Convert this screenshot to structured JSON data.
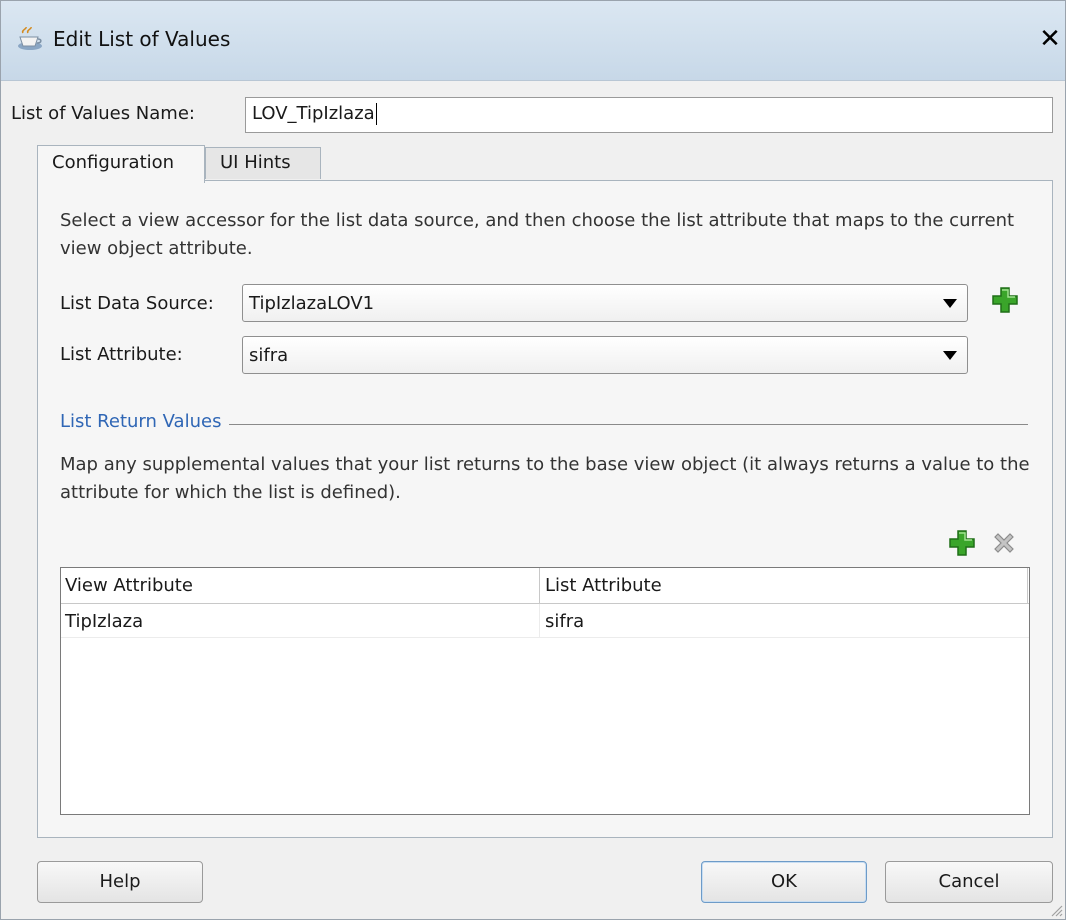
{
  "window": {
    "title": "Edit List of Values",
    "close_glyph": "✕"
  },
  "name_field": {
    "label": "List of Values Name:",
    "value": "LOV_TipIzlaza"
  },
  "tabs": [
    {
      "label": "Configuration",
      "selected": true
    },
    {
      "label": "UI Hints",
      "selected": false
    }
  ],
  "configuration": {
    "description": "Select a view accessor for the list data source, and then choose the list attribute that maps to the current view object attribute.",
    "data_source": {
      "label": "List Data Source:",
      "value": "TipIzlazaLOV1"
    },
    "list_attribute": {
      "label": "List Attribute:",
      "value": "sifra"
    },
    "return_values": {
      "title": "List Return Values",
      "description": "Map any supplemental values that your list returns to the base view object (it always returns a value to the attribute for which the list is defined).",
      "columns": [
        "View Attribute",
        "List Attribute"
      ],
      "rows": [
        [
          "TipIzlaza",
          "sifra"
        ]
      ]
    }
  },
  "buttons": {
    "help": "Help",
    "ok": "OK",
    "cancel": "Cancel"
  },
  "icons": {
    "title": "coffee-cup-icon",
    "add": "green-plus-icon",
    "remove": "gray-x-icon",
    "dropdown": "triangle-down-icon"
  },
  "colors": {
    "title_bar": "#c7d8e8",
    "section_title": "#2f66b5",
    "add_icon": "#3aa52a"
  }
}
